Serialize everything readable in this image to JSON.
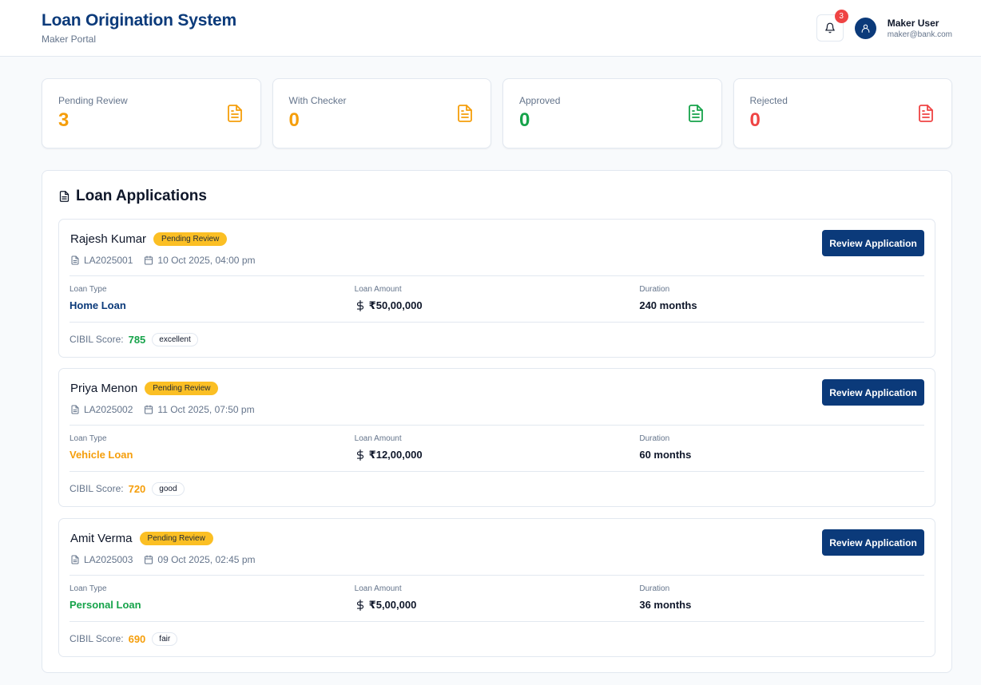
{
  "header": {
    "title": "Loan Origination System",
    "subtitle": "Maker Portal",
    "notifications_count": "3",
    "user_name": "Maker User",
    "user_email": "maker@bank.com"
  },
  "stats": [
    {
      "label": "Pending Review",
      "value": "3",
      "color": "#f59e0b"
    },
    {
      "label": "With Checker",
      "value": "0",
      "color": "#f59e0b"
    },
    {
      "label": "Approved",
      "value": "0",
      "color": "#16a34a"
    },
    {
      "label": "Rejected",
      "value": "0",
      "color": "#ef4444"
    }
  ],
  "applications_panel": {
    "title": "Loan Applications",
    "loan_type_label": "Loan Type",
    "loan_amount_label": "Loan Amount",
    "duration_label": "Duration",
    "cibil_label": "CIBIL Score:",
    "review_button_label": "Review Application"
  },
  "applications": [
    {
      "name": "Rajesh Kumar",
      "status": "Pending Review",
      "id": "LA2025001",
      "date": "10 Oct 2025, 04:00 pm",
      "loan_type": "Home Loan",
      "loan_type_color": "#0b3a7a",
      "amount": "₹50,00,000",
      "duration": "240 months",
      "cibil": "785",
      "cibil_color": "#16a34a",
      "cibil_rating": "excellent"
    },
    {
      "name": "Priya Menon",
      "status": "Pending Review",
      "id": "LA2025002",
      "date": "11 Oct 2025, 07:50 pm",
      "loan_type": "Vehicle Loan",
      "loan_type_color": "#f59e0b",
      "amount": "₹12,00,000",
      "duration": "60 months",
      "cibil": "720",
      "cibil_color": "#f59e0b",
      "cibil_rating": "good"
    },
    {
      "name": "Amit Verma",
      "status": "Pending Review",
      "id": "LA2025003",
      "date": "09 Oct 2025, 02:45 pm",
      "loan_type": "Personal Loan",
      "loan_type_color": "#16a34a",
      "amount": "₹5,00,000",
      "duration": "36 months",
      "cibil": "690",
      "cibil_color": "#f59e0b",
      "cibil_rating": "fair"
    }
  ]
}
